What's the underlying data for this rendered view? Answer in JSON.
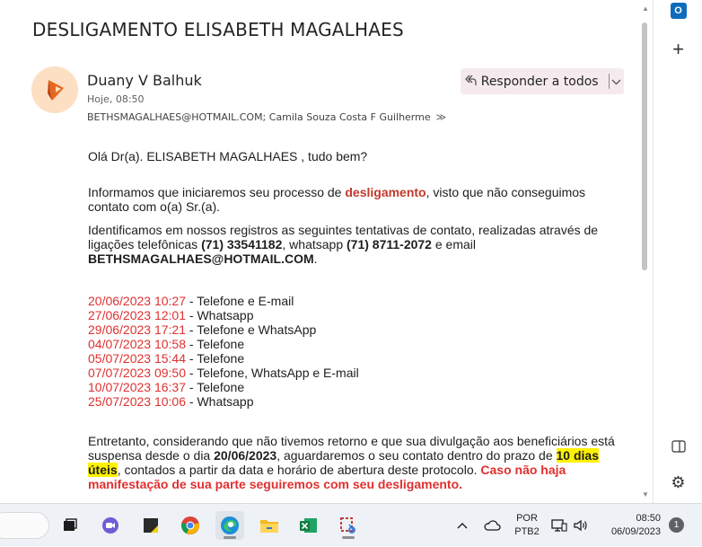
{
  "email": {
    "subject": "DESLIGAMENTO ELISABETH MAGALHAES",
    "sender": "Duany V Balhuk",
    "time": "Hoje, 08:50",
    "recipients": "BETHSMAGALHAES@HOTMAIL.COM; Camila Souza Costa F Guilherme",
    "reply_all_label": "Responder a todos",
    "greeting": "Olá Dr(a). ELISABETH MAGALHAES , tudo bem?",
    "p1_before": "Informamos que iniciaremos seu processo de ",
    "p1_highlight": "desligamento",
    "p1_after": ", visto que não conseguimos contato com o(a) Sr.(a).",
    "p2_a": "Identificamos em nossos registros as seguintes tentativas de contato, realizadas através de ligações telefônicas ",
    "p2_phone": "(71) 33541182",
    "p2_b": ", whatsapp ",
    "p2_whatsapp": "(71) 8711-2072",
    "p2_c": " e email ",
    "p2_email": "BETHSMAGALHAES@HOTMAIL.COM",
    "p2_d": ".",
    "contacts": [
      {
        "date": "20/06/2023 10:27",
        "channel": " - Telefone e E-mail"
      },
      {
        "date": "27/06/2023 12:01",
        "channel": " - Whatsapp"
      },
      {
        "date": "29/06/2023 17:21",
        "channel": " - Telefone e WhatsApp"
      },
      {
        "date": "04/07/2023 10:58",
        "channel": " - Telefone"
      },
      {
        "date": "05/07/2023 15:44",
        "channel": " - Telefone"
      },
      {
        "date": "07/07/2023 09:50",
        "channel": " - Telefone, WhatsApp e E-mail"
      },
      {
        "date": "10/07/2023 16:37",
        "channel": " - Telefone"
      },
      {
        "date": "25/07/2023 10:06",
        "channel": " - Whatsapp"
      }
    ],
    "p3_a": "Entretanto, considerando que não tivemos retorno e que sua divulgação aos beneficiários está suspensa desde o dia ",
    "p3_date": "20/06/2023",
    "p3_b": ", aguardaremos o seu contato dentro do prazo de ",
    "p3_deadline": "10 dias úteis",
    "p3_c": ", contados a partir da data e horário de abertura deste protocolo. ",
    "p3_warning": "Caso não haja manifestação de sua parte seguiremos com seu desligamento."
  },
  "colors": {
    "accent_red": "#e03030",
    "highlight_yellow": "#fff200",
    "reply_button_bg": "#f5ebee",
    "outlook_blue": "#0f6cbd"
  },
  "rail": {
    "icons": [
      "outlook-icon",
      "add-icon",
      "panel-icon",
      "gear-icon"
    ]
  },
  "taskbar": {
    "apps": [
      "task-view-icon",
      "teams-icon",
      "sticky-notes-icon",
      "chrome-icon",
      "edge-icon",
      "file-explorer-icon",
      "excel-icon",
      "snipping-tool-icon"
    ],
    "lang_line1": "POR",
    "lang_line2": "PTB2",
    "time": "08:50",
    "date": "06/09/2023",
    "notification_count": "1"
  }
}
